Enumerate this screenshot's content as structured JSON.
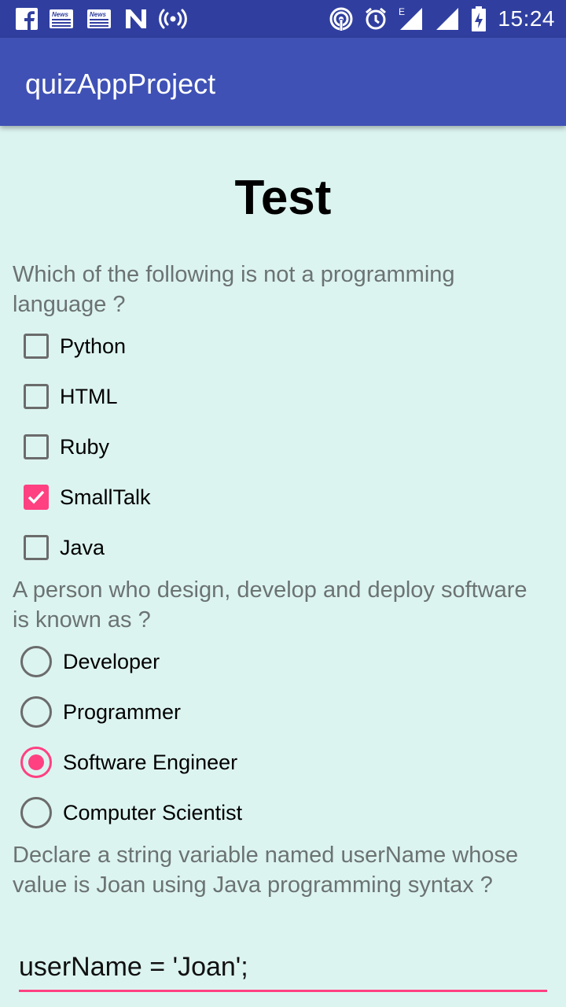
{
  "status_bar": {
    "time": "15:24",
    "left_icons": [
      "facebook-icon",
      "news-icon",
      "news-icon",
      "n-app-icon",
      "hotspot-icon"
    ],
    "right_icons": [
      "hotspot-signal-icon",
      "alarm-icon",
      "signal-e-icon",
      "signal-icon",
      "battery-charging-icon"
    ],
    "news_label": "News",
    "network_label": "E"
  },
  "app_bar": {
    "title": "quizAppProject"
  },
  "page": {
    "title": "Test"
  },
  "questions": [
    {
      "text": "Which of the following is not a programming language ?",
      "type": "checkbox",
      "options": [
        {
          "label": "Python",
          "checked": false
        },
        {
          "label": "HTML",
          "checked": false
        },
        {
          "label": "Ruby",
          "checked": false
        },
        {
          "label": "SmallTalk",
          "checked": true
        },
        {
          "label": "Java",
          "checked": false
        }
      ]
    },
    {
      "text": "A person who design, develop and deploy software is known as ?",
      "type": "radio",
      "options": [
        {
          "label": "Developer",
          "checked": false
        },
        {
          "label": "Programmer",
          "checked": false
        },
        {
          "label": "Software Engineer",
          "checked": true
        },
        {
          "label": "Computer Scientist",
          "checked": false
        }
      ]
    },
    {
      "text": "Declare a string variable named userName whose value is Joan using Java programming syntax ?",
      "type": "text",
      "value": "userName = 'Joan';"
    }
  ],
  "colors": {
    "status_bar": "#303f9f",
    "app_bar": "#3f51b5",
    "accent": "#ff4081",
    "background": "#dcf4f0"
  }
}
